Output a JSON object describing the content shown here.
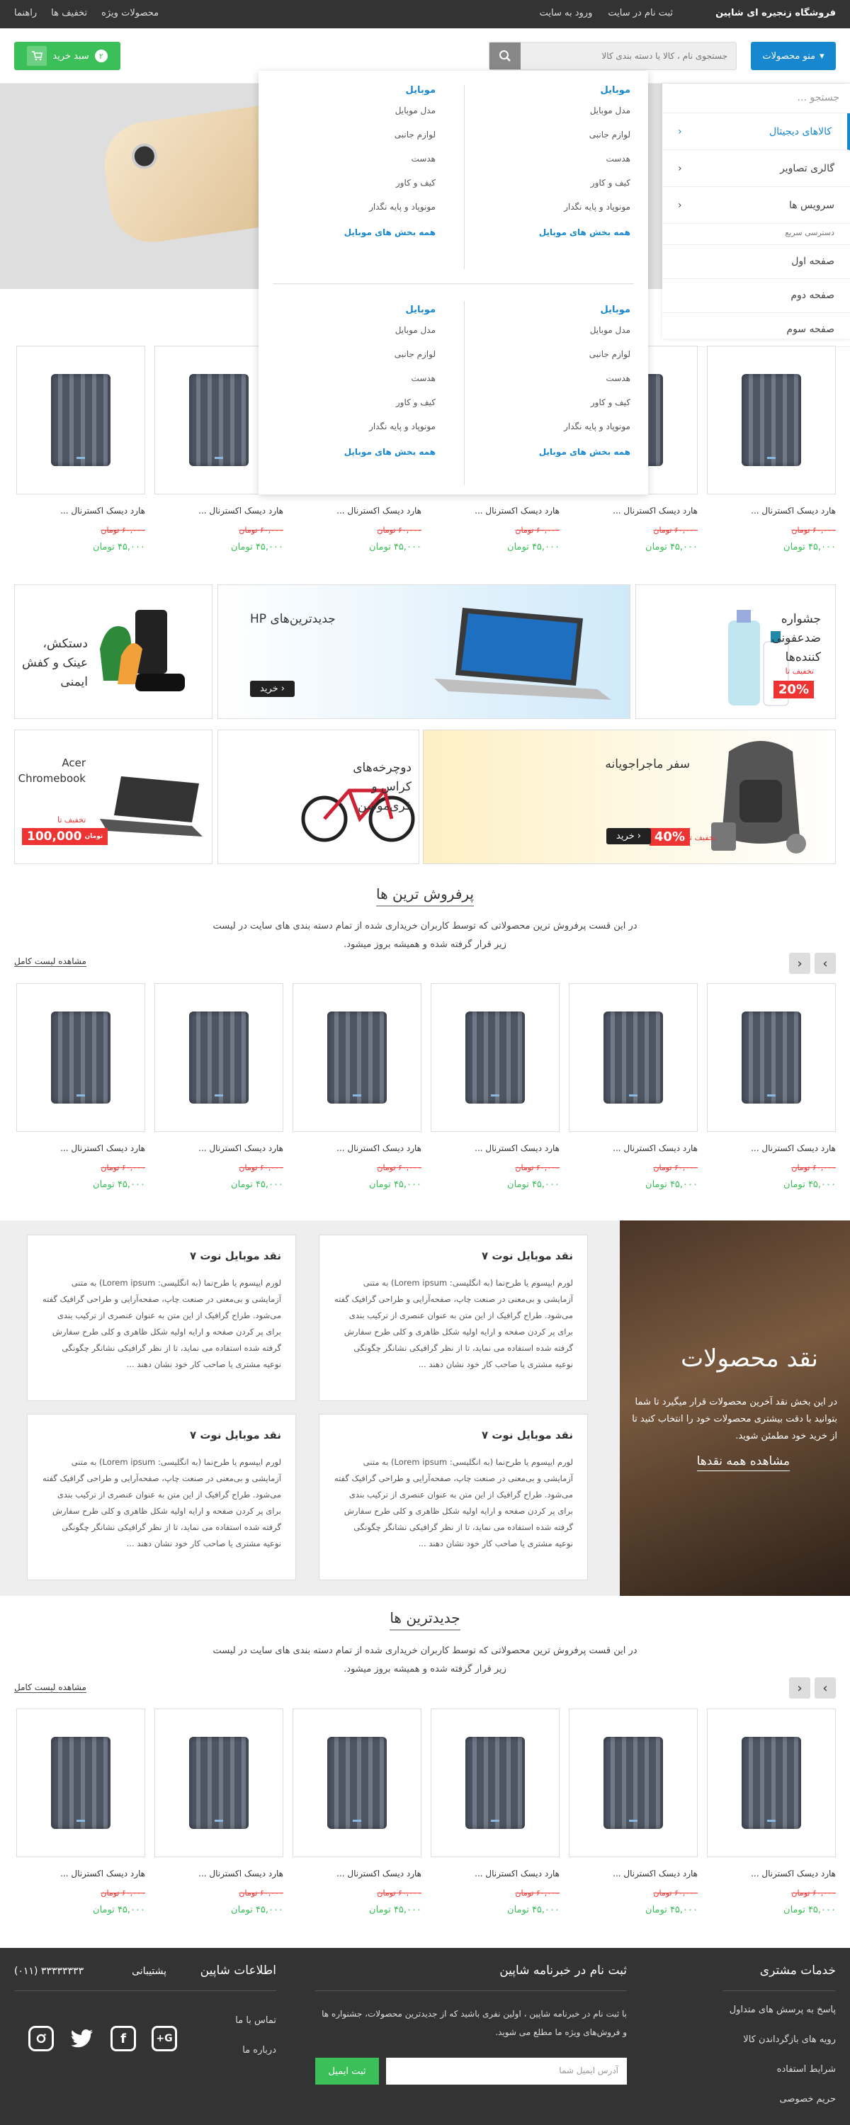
{
  "topbar": {
    "brand": "فروشگاه زنجیره ای شاپین",
    "actions": [
      "ثبت نام در سایت",
      "ورود به سایت"
    ],
    "links": [
      "محصولات ویژه",
      "تخفیف ها",
      "راهنما"
    ]
  },
  "header": {
    "menu_label": "منو محصولات",
    "search_placeholder": "جستجوی نام ، کالا یا دسته بندی کالا",
    "cart_label": "سبد خرید",
    "cart_count": "۲"
  },
  "sidebar": {
    "search": "جستجو ...",
    "items": [
      {
        "label": "کالاهای دیجیتال",
        "active": true
      },
      {
        "label": "گالری تصاویر"
      },
      {
        "label": "سرویس ها"
      }
    ],
    "quick_title": "دسترسی سریع",
    "pages": [
      "صفحه اول",
      "صفحه دوم",
      "صفحه سوم"
    ]
  },
  "mega": {
    "heading": "موبایل",
    "items": [
      "مدل موبایل",
      "لوازم جانبی",
      "هدست",
      "کیف و کاور",
      "مونوپاد و پایه نگدار"
    ],
    "all": "همه بخش های موبایل"
  },
  "product": {
    "name": "هارد دیسک اکسترنال ...",
    "old_price": "۶۰,۰۰۰ تومان",
    "new_price": "۴۵,۰۰۰ تومان"
  },
  "banners": {
    "b1": "جشواره ضدعفونی کننده‌ها",
    "b1_disc_label": "تخفیف تا",
    "b1_disc": "20%",
    "b2": "جدیدترین‌های HP",
    "b2_btn": "خرید",
    "b3": "دستکش، عینک و کفش ایمنی",
    "b4": "سفر ماجراجویانه",
    "b4_disc_label": "تخفیف تا",
    "b4_disc": "40%",
    "b4_btn": "خرید",
    "b5": "دوچرخه‌های کراس و فری‌موشن",
    "b6": "Acer Chromebook",
    "b6_disc_label": "تخفیف تا",
    "b6_disc": "100,000",
    "b6_unit": "تومان"
  },
  "bestsellers": {
    "title": "پرفروش ترین ها",
    "desc": "در این قست پرفروش ترین محصولاتی که توسط کاربران خریداری شده از تمام دسته بندی های سایت در لیست زیر قرار گرفته شده و همیشه بروز میشود.",
    "view_all": "مشاهده لیست کامل"
  },
  "reviews": {
    "title": "نقد محصولات",
    "desc": "در این بخش نقد آخرین محصولات قرار میگیرد تا شما بتوانید با دقت بیشتری محصولات خود را انتخاب کنید تا از خرید خود مطمئن شوید.",
    "all": "مشاهده همه نقدها",
    "card_title": "نقد موبایل نوت ۷",
    "card_body": "لورم ایپسوم یا طرح‌نما (به انگلیسی: Lorem ipsum) به متنی آزمایشی و بی‌معنی در صنعت چاپ، صفحه‌آرایی و طراحی گرافیک گفته می‌شود. طراح گرافیک از این متن به عنوان عنصری از ترکیب بندی برای پر کردن صفحه و ارایه اولیه شکل ظاهری و کلی طرح سفارش گرفته شده استفاده می نماید، تا از نظر گرافیکی نشانگر چگونگی نوعیه مشتری یا صاحب کار خود نشان دهند ..."
  },
  "newest": {
    "title": "جدیدترین ها",
    "desc": "در این قست پرفروش ترین محصولاتی که توسط کاربران خریداری شده از تمام دسته بندی های سایت در لیست زیر قرار گرفته شده و همیشه بروز میشود.",
    "view_all": "مشاهده لیست کامل"
  },
  "footer": {
    "services_title": "خدمات مشتری",
    "services": [
      "پاسخ به پرسش های متداول",
      "رویه های بازگرداندن کالا",
      "شرایط استفاده",
      "حریم خصوصی"
    ],
    "newsletter_title": "ثبت نام در خبرنامه شاپین",
    "newsletter_desc": "با ثبت نام در خبرنامه شاپین ، اولین نفری باشید که از جدیدترین محصولات، جشنواره ها و فروش‌های ویژه ما مطلع می شوید.",
    "email_placeholder": "آدرس ایمیل شما",
    "subscribe": "ثبت ایمیل",
    "info_title": "اطلاعات شاپین",
    "support_label": "پشتیبانی",
    "support_phone": "(۰۱۱) ۳۳۳۳۳۳۳۳",
    "info_links": [
      "تماس با ما",
      "درباره ما"
    ]
  }
}
